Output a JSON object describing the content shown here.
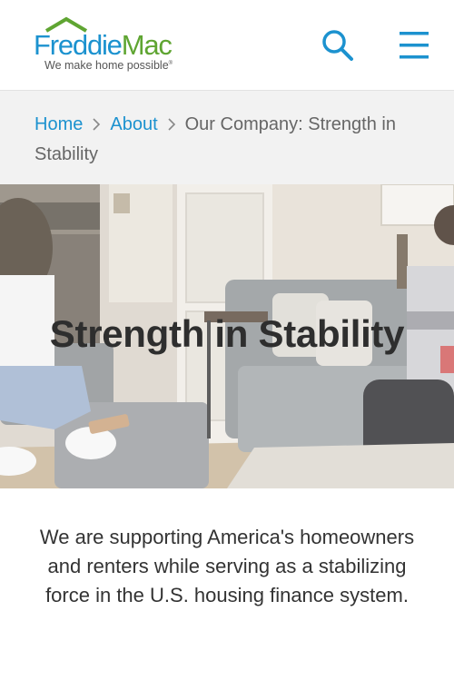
{
  "header": {
    "logo": {
      "name_part1": "Freddie",
      "name_part2": "Mac",
      "tagline": "We make home possible",
      "tagline_mark": "®"
    },
    "search_icon": "search-icon",
    "menu_icon": "hamburger-menu-icon"
  },
  "breadcrumb": {
    "items": [
      {
        "label": "Home",
        "link": true
      },
      {
        "label": "About",
        "link": true
      },
      {
        "label": "Our Company: Strength in Stability",
        "link": false
      }
    ],
    "separator": ">"
  },
  "hero": {
    "title": "Strength in Stability"
  },
  "intro": {
    "text": "We are supporting America's homeowners and renters while serving as a stabilizing force in the U.S. housing finance system."
  },
  "colors": {
    "brand_blue": "#1c92cf",
    "brand_green": "#5fa532",
    "breadcrumb_bg": "#f2f2f2"
  }
}
